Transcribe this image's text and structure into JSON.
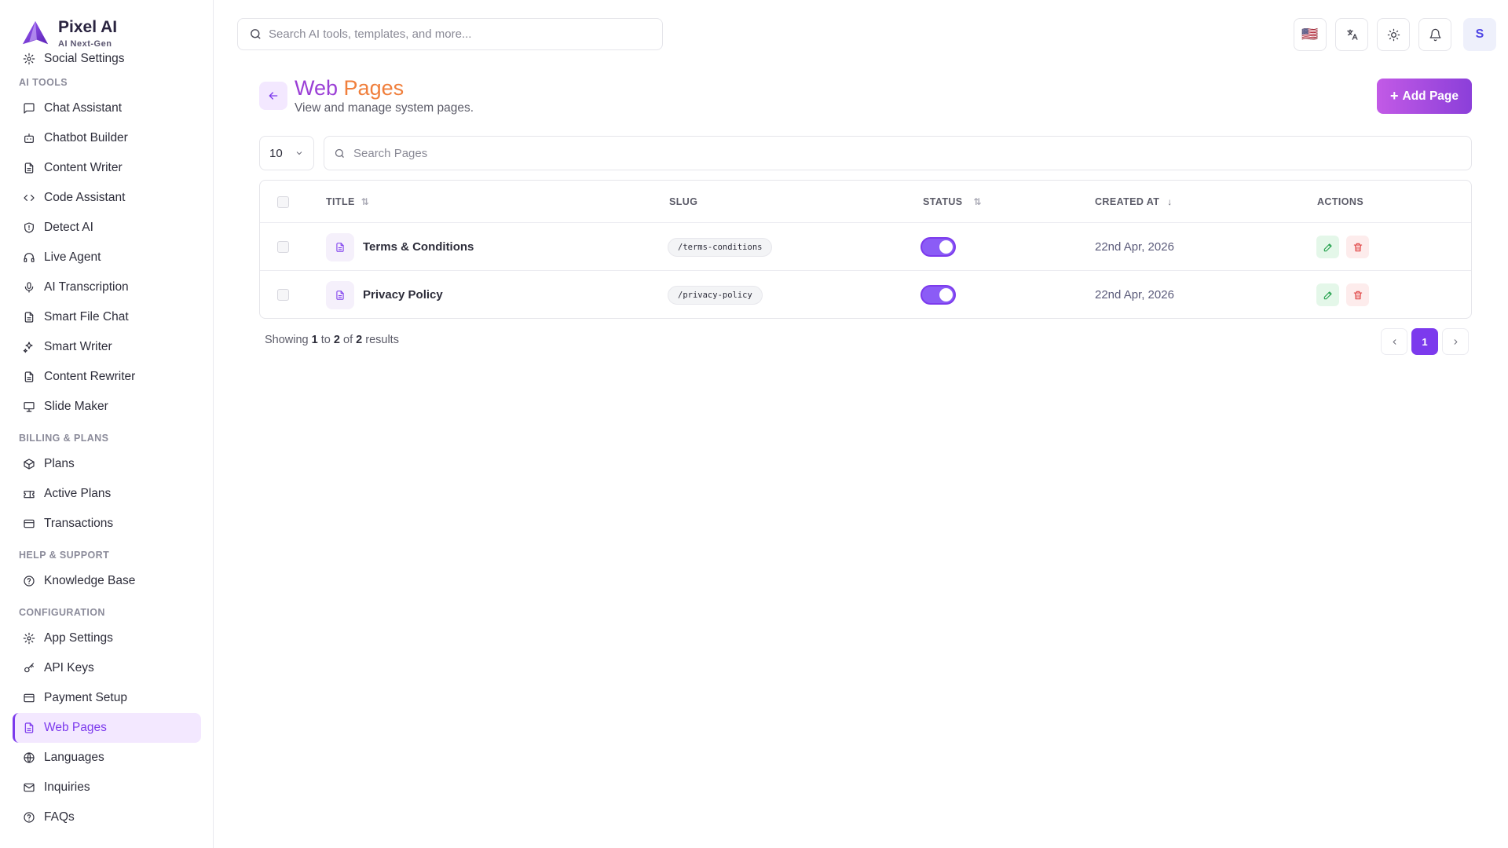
{
  "brand": {
    "name": "Pixel AI",
    "tagline": "AI Next-Gen"
  },
  "search": {
    "placeholder": "Search AI tools, templates, and more..."
  },
  "topbar": {
    "avatar_initial": "S",
    "flag": "🇺🇸"
  },
  "sidebar": {
    "clipped_item": "Social Settings",
    "sections": [
      {
        "label": "AI TOOLS",
        "items": [
          "Chat Assistant",
          "Chatbot Builder",
          "Content Writer",
          "Code Assistant",
          "Detect AI",
          "Live Agent",
          "AI Transcription",
          "Smart File Chat",
          "Smart Writer",
          "Content Rewriter",
          "Slide Maker"
        ]
      },
      {
        "label": "BILLING & PLANS",
        "items": [
          "Plans",
          "Active Plans",
          "Transactions"
        ]
      },
      {
        "label": "HELP & SUPPORT",
        "items": [
          "Knowledge Base"
        ]
      },
      {
        "label": "CONFIGURATION",
        "items": [
          "App Settings",
          "API Keys",
          "Payment Setup",
          "Web Pages",
          "Languages",
          "Inquiries",
          "FAQs"
        ]
      }
    ],
    "active": "Web Pages"
  },
  "page": {
    "title_part1": "Web",
    "title_part2": "Pages",
    "subtitle": "View and manage system pages.",
    "add_button": "Add Page"
  },
  "controls": {
    "per_page": "10",
    "search_placeholder": "Search Pages"
  },
  "table": {
    "columns": {
      "title": "TITLE",
      "slug": "SLUG",
      "status": "STATUS",
      "created_at": "CREATED AT",
      "actions": "ACTIONS"
    },
    "rows": [
      {
        "title": "Terms & Conditions",
        "slug": "/terms-conditions",
        "status": true,
        "created_at": "22nd Apr, 2026"
      },
      {
        "title": "Privacy Policy",
        "slug": "/privacy-policy",
        "status": true,
        "created_at": "22nd Apr, 2026"
      }
    ]
  },
  "footer": {
    "showing_prefix": "Showing",
    "from": "1",
    "to_word": "to",
    "to": "2",
    "of_word": "of",
    "total": "2",
    "suffix": "results",
    "current_page": "1"
  },
  "colors": {
    "accent": "#7c3aed",
    "title_purple": "#9b3fd6",
    "title_orange": "#f07f3c",
    "edit_green": "#22a04b",
    "delete_red": "#e04545"
  }
}
